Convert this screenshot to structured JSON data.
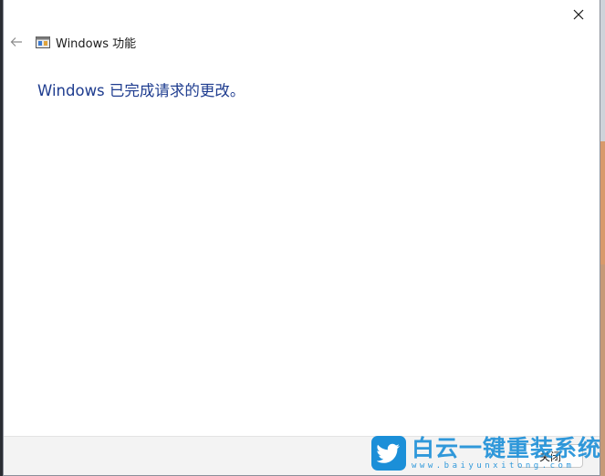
{
  "dialog": {
    "title": "Windows 功能",
    "message": "Windows 已完成请求的更改。",
    "close_button_label": "关闭",
    "icons": {
      "back": "back-arrow-icon",
      "app": "windows-features-icon",
      "close": "close-icon"
    }
  },
  "watermark": {
    "name": "白云一键重装系统",
    "url": "www.baiyunxitong.com",
    "color": "#1b8fd8"
  },
  "colors": {
    "message": "#1e3c8f",
    "footer": "#f3f3f3"
  }
}
